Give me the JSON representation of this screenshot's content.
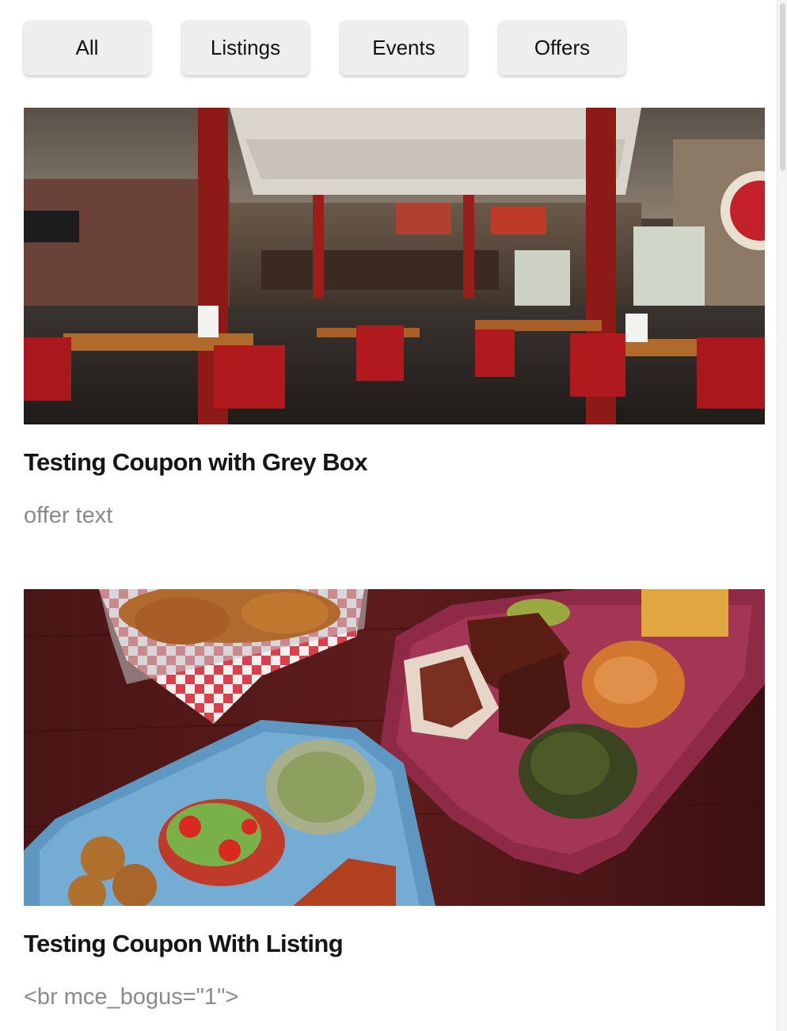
{
  "filters": {
    "all_label": "All",
    "listings_label": "Listings",
    "events_label": "Events",
    "offers_label": "Offers"
  },
  "cards": [
    {
      "title": "Testing Coupon with Grey Box",
      "text": "offer text",
      "image_alt": "Restaurant interior with red chairs and wooden tables"
    },
    {
      "title": "Testing Coupon With Listing",
      "text": "<br mce_bogus=\"1\">",
      "image_alt": "Barbecue trays with ribs, fried chicken and sides"
    }
  ],
  "colors": {
    "button_bg": "#eeeeee",
    "title": "#151515",
    "muted_text": "#8a8a8a"
  }
}
